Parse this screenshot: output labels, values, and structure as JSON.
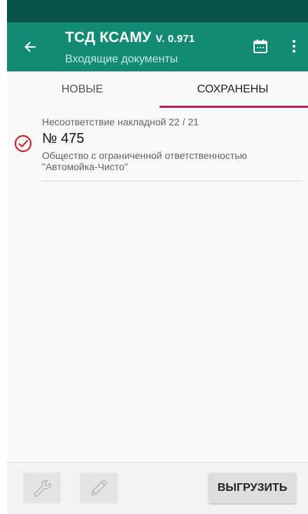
{
  "app_bar": {
    "title": "ТСД КСАМУ",
    "version": "V. 0.971",
    "subtitle": "Входящие документы",
    "back_icon": "arrow-left-icon",
    "calendar_icon": "calendar-icon",
    "more_icon": "more-vertical-icon"
  },
  "tabs": [
    {
      "label": "НОВЫЕ",
      "selected": false
    },
    {
      "label": "СОХРАНЕНЫ",
      "selected": true
    }
  ],
  "documents": [
    {
      "type": "Несоответствие накладной 22 / 21",
      "number": "№ 475",
      "organization": "Общество с ограниченной ответственностью \"Автомойка-Чисто\"",
      "status_icon": "check-circle-icon"
    }
  ],
  "bottom_bar": {
    "settings_icon": "wrench-icon",
    "edit_icon": "pencil-icon",
    "upload_label": "ВЫГРУЗИТЬ"
  },
  "colors": {
    "status_bar": "#0a5448",
    "app_bar": "#138a73",
    "tab_indicator": "#c2185b",
    "status_check": "#c62828"
  }
}
